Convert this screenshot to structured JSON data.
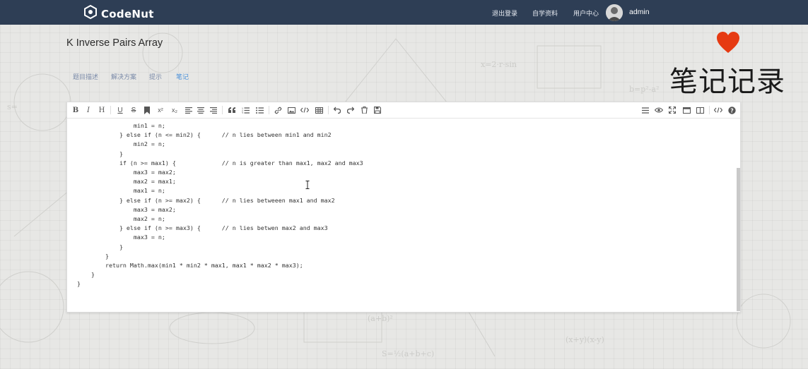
{
  "navbar": {
    "logo_text": "CodeNut",
    "logout": "退出登录",
    "study": "自学资料",
    "user_center": "用户中心",
    "username": "admin"
  },
  "page": {
    "title": "K Inverse Pairs Array",
    "tabs": [
      "题目描述",
      "解决方案",
      "提示",
      "笔记"
    ],
    "active_tab": "笔记",
    "notes_heading": "笔记记录"
  },
  "toolbar": {
    "bold": "B",
    "italic": "I",
    "heading": "H",
    "underline": "U",
    "strike": "S",
    "superscript": "x²",
    "subscript": "x₂"
  },
  "code_lines": [
    "                min1 = n;",
    "            } else if (n <= min2) {      // n lies between min1 and min2",
    "                min2 = n;",
    "            }",
    "            if (n >= max1) {             // n is greater than max1, max2 and max3",
    "                max3 = max2;",
    "                max2 = max1;",
    "                max1 = n;",
    "            } else if (n >= max2) {      // n lies betweeen max1 and max2",
    "                max3 = max2;",
    "                max2 = n;",
    "            } else if (n >= max3) {      // n lies betwen max2 and max3",
    "                max3 = n;",
    "            }",
    "        }",
    "        return Math.max(min1 * min2 * max1, max1 * max2 * max3);",
    "    }",
    "}"
  ],
  "colors": {
    "navbar_bg": "#2e3e55",
    "heart": "#e63a12",
    "active_tab": "#4a90d9"
  }
}
